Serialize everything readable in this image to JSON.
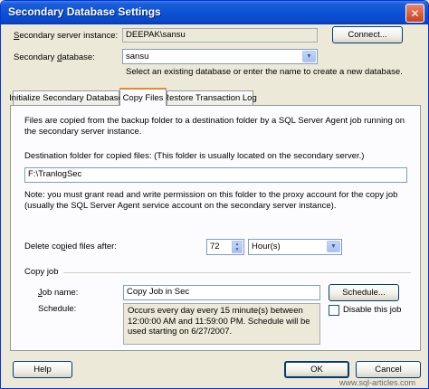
{
  "window": {
    "title": "Secondary Database Settings",
    "close_glyph": "✕"
  },
  "server": {
    "label_prefix": "",
    "label_underlined": "S",
    "label_rest": "econdary server instance:",
    "value": "DEEPAK\\sansu",
    "connect_label": "Connect..."
  },
  "database": {
    "label_prefix": "Secondary ",
    "label_underlined": "d",
    "label_rest": "atabase:",
    "value": "sansu",
    "hint": "Select an existing database or enter the name to create a new database."
  },
  "tabs": [
    {
      "label": "Initialize Secondary Database",
      "active": false
    },
    {
      "label": "Copy Files",
      "active": true
    },
    {
      "label": "Restore Transaction Log",
      "active": false
    }
  ],
  "copy_files": {
    "intro": "Files are copied from the backup folder to a destination folder by a SQL Server Agent job running on the secondary server instance.",
    "dest_label": "Destination folder for copied files: (This folder is usually located on the secondary server.)",
    "dest_value": "F:\\TranlogSec",
    "note": "Note: you must grant read and write permission on this folder to the proxy account for the copy job (usually the SQL Server Agent service account on the secondary server instance).",
    "delete_label_prefix": "Delete co",
    "delete_label_underlined": "p",
    "delete_label_rest": "ied files after:",
    "delete_value": "72",
    "delete_unit": "Hour(s)",
    "copy_job_header": "Copy job",
    "job_name_label_underlined": "J",
    "job_name_label_rest": "ob name:",
    "job_name_value": "Copy Job in Sec",
    "schedule_button": "Schedule...",
    "schedule_label": "Schedule:",
    "schedule_text": "Occurs every day every 15 minute(s) between 12:00:00 AM and 11:59:00 PM. Schedule will be used starting on 6/27/2007.",
    "disable_label": "Disable this job",
    "disable_checked": false
  },
  "footer": {
    "help_label": "Help",
    "ok_label": "OK",
    "cancel_label": "Cancel",
    "watermark": "www.sql-articles.com"
  }
}
